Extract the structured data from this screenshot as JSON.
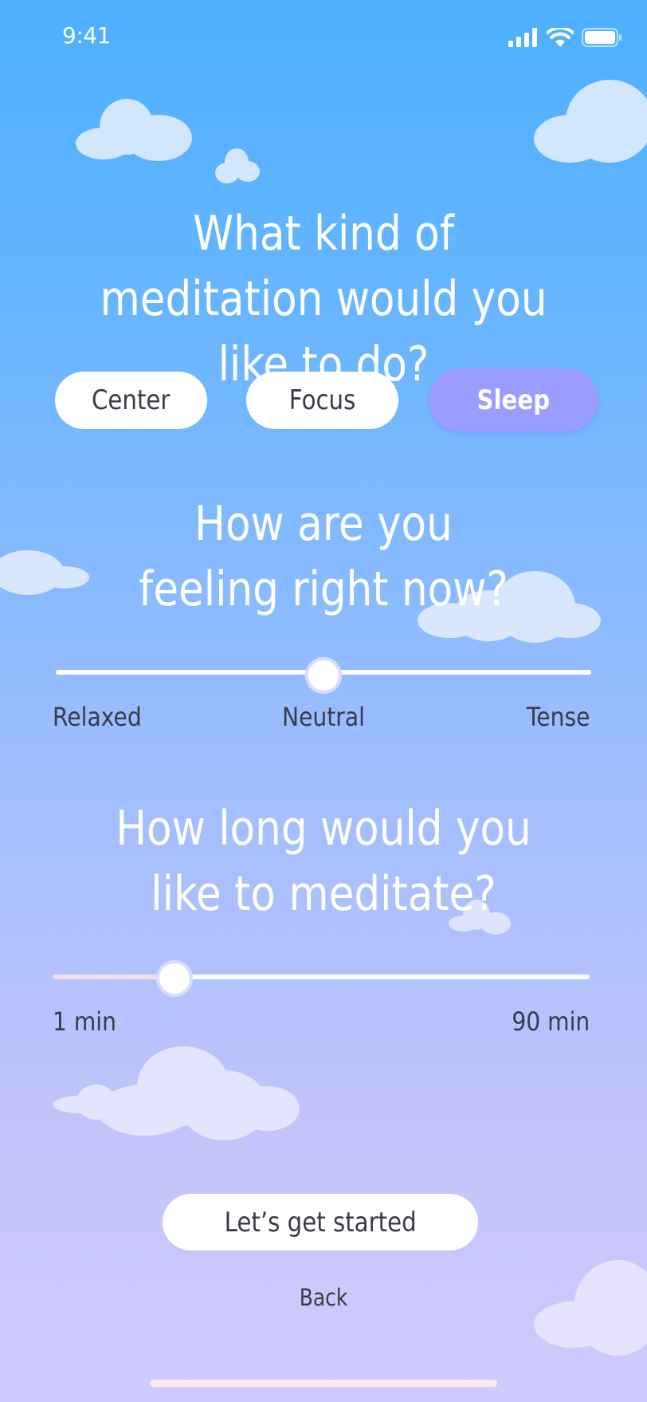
{
  "status_bar": {
    "time": "9:41"
  },
  "meditation_type": {
    "question": "What kind of meditation would you like to do?",
    "options": [
      {
        "label": "Center",
        "selected": false
      },
      {
        "label": "Focus",
        "selected": false
      },
      {
        "label": "Sleep",
        "selected": true
      }
    ],
    "active_color": "#9b9cff"
  },
  "feeling": {
    "question": "How are you feeling right now?",
    "labels": [
      "Relaxed",
      "Neutral",
      "Tense"
    ],
    "value": 0.5
  },
  "duration": {
    "question": "How long would you like to meditate?",
    "min_label": "1 min",
    "max_label": "90 min",
    "value_fraction": 0.22
  },
  "actions": {
    "primary": "Let’s get started",
    "secondary": "Back"
  }
}
